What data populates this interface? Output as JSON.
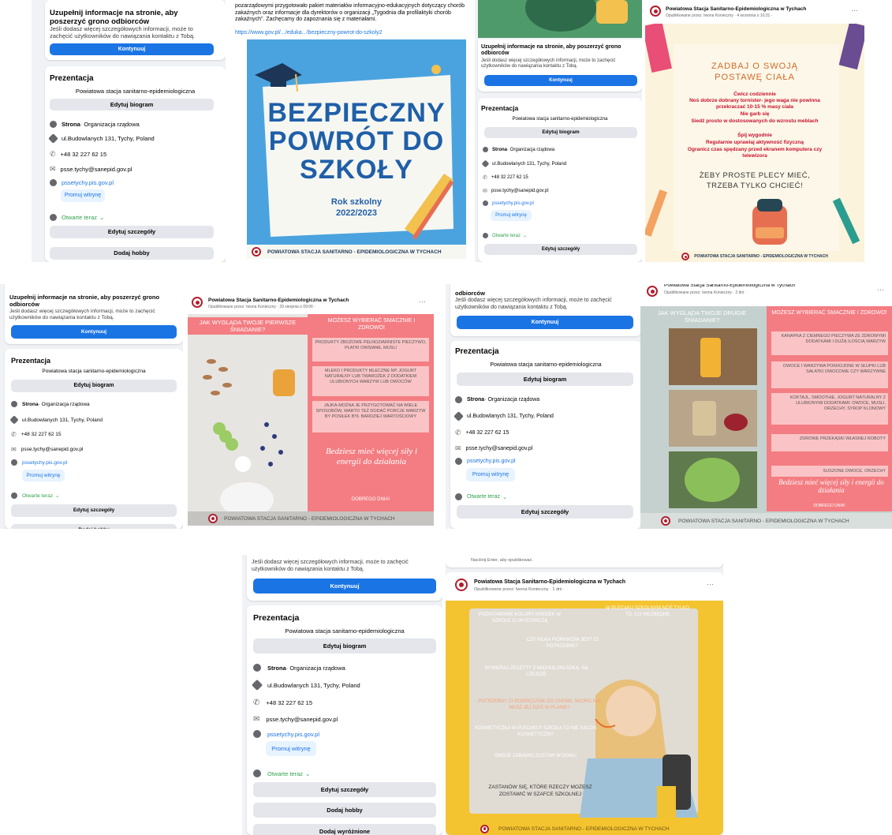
{
  "profile": {
    "intro_heading": "Uzupełnij informacje na stronie, aby poszerzyć grono odbiorców",
    "intro_heading_cut": "odbiorców",
    "intro_text": "Jeśli dodasz więcej szczegółowych informacji, może to zachęcić użytkowników do nawiązania kontaktu z Tobą.",
    "continue": "Kontynuuj",
    "section": "Prezentacja",
    "bio": "Powiatowa stacja sanitarno-epidemiologiczna",
    "edit_bio": "Edytuj biogram",
    "category_bold": "Strona",
    "category_rest": " · Organizacja rządowa",
    "address": "ul.Budowlanych 131, Tychy, Poland",
    "phone": "+48 32 227 62 15",
    "email": "psse.tychy@sanepid.gov.pl",
    "website": "pssetychy.pis.gov.pl",
    "promote": "Promuj witrynę",
    "open_now": "Otwarte teraz",
    "edit_details": "Edytuj szczegóły",
    "add_hobby": "Dodaj hobby",
    "add_featured": "Dodaj wyróżnione",
    "add_featured_cut": "Dodaj wyr..."
  },
  "page_name": "Powiatowa Stacja Sanitarno-Epidemiologiczna w Tychach",
  "footer_text": "POWIATOWA STACJA SANITARNO - EPIDEMIOLOGICZNA W TYCHACH",
  "footer_text_caps": "POWIATOWA STACJA SANITARNO - EPIDEMIOLOGICZNA W TYCHACH",
  "post1": {
    "body": "pozarządowymi przygotowało pakiet materiałów informacyjno-edukacyjnych dotyczący chorób zakaźnych oraz informacje dla dyrektorów o organizacji „Tygodnia dla profilaktyki chorób zakaźnych”. Zachęcamy do zapoznania się z materiałami.",
    "link": "https://www.gov.pl/.../eduka.../bezpieczny-powrot-do-szkoly2",
    "title1": "BEZPIECZNY",
    "title2": "POWRÓT DO",
    "title3": "SZKOŁY",
    "year1": "Rok szkolny",
    "year2": "2022/2023"
  },
  "post2": {
    "meta": "Opublikowane przez: Iwona Konieczny · 4 września o 10:31 · ",
    "heading1": "ZADBAJ O SWOJĄ",
    "heading2": "POSTAWĘ CIAŁA",
    "lines": [
      "Ćwicz codziennie",
      "Noś dobrze dobrany tornister- jego waga nie powinna przekraczać 10-15 % masy ciała",
      "Nie garb się",
      "Siedź prosto w dostosowanych do wzrostu meblach",
      "Śpij wygodnie",
      "Regularnie uprawiaj aktywność fizyczną",
      "Ogranicz czas spędzany przed ekranem komputera czy telewizora"
    ],
    "slogan1": "ŻEBY PROSTE PLECY MIEĆ,",
    "slogan2": "TRZEBA TYLKO CHCIEĆ!"
  },
  "post3": {
    "meta": "Opublikowane przez: Iwona Konieczny · 29 sierpnia o 09:06 · ",
    "heading_left": "JAK WYGLĄDA TWOJE PIERWSZE ŚNIADANIE?",
    "heading_right": "MOŻESZ WYBIERAĆ SMACZNIE I ZDROWO!",
    "boxes": [
      "PRODUKTY ZBOŻOWE PEŁNOZIARNISTE PIECZYWO, PŁATKI OWSIANE, MUSLI",
      "MLEKO I PRODUKTY MLECZNE NP. JOGURT NATURALNY LUB TWAROŻEK Z DODATKIEM ULUBIONYCH WARZYW LUB OWOCÓW",
      "JAJKA-MOŻNA JE PRZYGOTOWAĆ NA WIELE SPOSOBÓW, WARTO TEŻ DODAĆ PORCJE WARZYW BY POSIŁEK BYŁ BARDZIEJ WARTOŚCIOWY"
    ],
    "script": "Bedziesz mieć więcej siły i energii do działania",
    "smacznego": "DOBREGO DNIA!"
  },
  "post4": {
    "meta": "Opublikowane przez: Iwona Konieczny · 2 dni · ",
    "heading_left": "JAK WYGLĄDA TWOJE DRUGIE ŚNIADANIE?",
    "heading_right": "MOŻESZ WYBIERAĆ SMACZNIE I ZDROWO!",
    "boxes": [
      "KANAPKA Z CIEMNEGO PIECZYWA ZE ZDROWYMI DODATKAMI I DUŻĄ ILOŚCIĄ WARZYW",
      "OWOCE I WARZYWA POKROJONE W SŁUPKI LUB SAŁATKI OWOCOWE CZY WARZYWNE",
      "KOKTAJL, SMOOTHIE, JOGURT NATURALNY Z ULUBIONYMI DODATKAMI: OWOCE, MUSLI, ORZECHY, SYROP KLONOWY",
      "ZDROWE PRZEKĄSKI WŁASNEJ ROBOTY",
      "SUSZONE OWOCE, ORZECHY"
    ],
    "script": "Bedziesz mieć więcej siły i energii do działania",
    "smacznego": "DOBREGO DNIA!"
  },
  "post5": {
    "publish_hint": "Naciśnij Enter, aby opublikować.",
    "meta": "Opublikowane przez: Iwona Konieczny · 1 dni · ",
    "lines": [
      "PODSTAWOWE KOLORY KREDEK W SZKOLE CI WYSTARCZĄ",
      "W PLECAKU SZKOLNYM NOŚ TYLKO TO, CO NIEZBĘDNE",
      "CZY KILKA PIÓRNIKÓW JEST CI POTRZEBNE?",
      "WYBIERAJ ZESZYTY Z MIĘKKĄ OKŁADKĄ- SĄ LŻEJSZE",
      "POTRZEBNY CI PODRĘCZNIK DO CHEMII, SKORO NIE MASZ JEJ DZIŚ W PLANIE?",
      "KOSMETYCZKA W PLECAKU? SZKOŁA TO NIE SALON KOSMETYCZNY",
      "SWOJE ZABAWKI ZOSTAW W DOMU",
      "ZASTANÓW SIĘ, KTÓRE RZECZY MOŻESZ ZOSTAWIĆ W SZAFCE SZKOLNEJ"
    ]
  },
  "colors": {
    "fb_blue": "#1b74e4",
    "poster1_blue": "#4aa3df",
    "poster2_cream": "#fbf3dc",
    "poster3_pink": "#f37d82",
    "poster4_grey": "#c5d1ce",
    "poster5_yellow": "#f4c430"
  }
}
